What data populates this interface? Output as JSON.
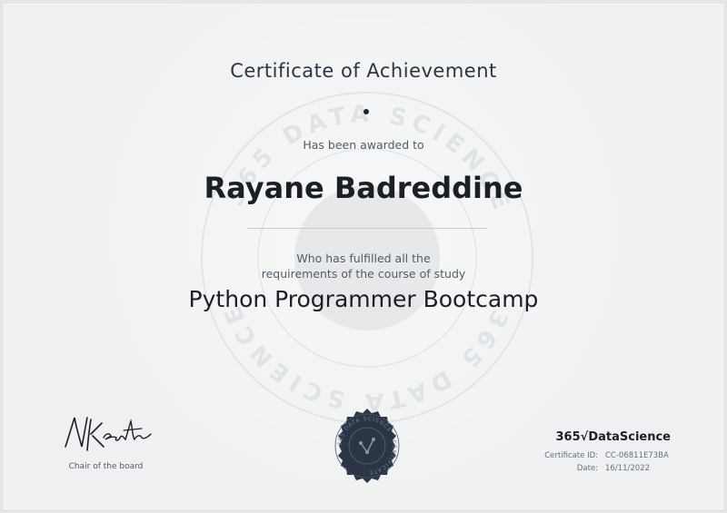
{
  "certificate": {
    "title": "Certificate of Achievement",
    "awarded_text": "Has been awarded to",
    "recipient_name": "Rayane Badreddine",
    "fulfilled_line1": "Who has fulfilled all the",
    "fulfilled_line2": "requirements of the course of study",
    "course_name": "Python Programmer Bootcamp"
  },
  "signature": {
    "text": "N Krastev",
    "caption": "Chair of the board"
  },
  "brand": {
    "name": "365√DataScience"
  },
  "details": {
    "certificate_id_label": "Certificate ID:",
    "certificate_id_value": "CC-06811E73BA",
    "date_label": "Date:",
    "date_value": "16/11/2022"
  },
  "watermark": {
    "text": "365 DATA SCIENCE"
  },
  "seal": {
    "text": "365 DATA SCIENCE · CERTIFICATE ·"
  },
  "colors": {
    "background": "#eef0f1",
    "text_dark": "#1c1f26",
    "seal_fill": "#2c3546"
  }
}
